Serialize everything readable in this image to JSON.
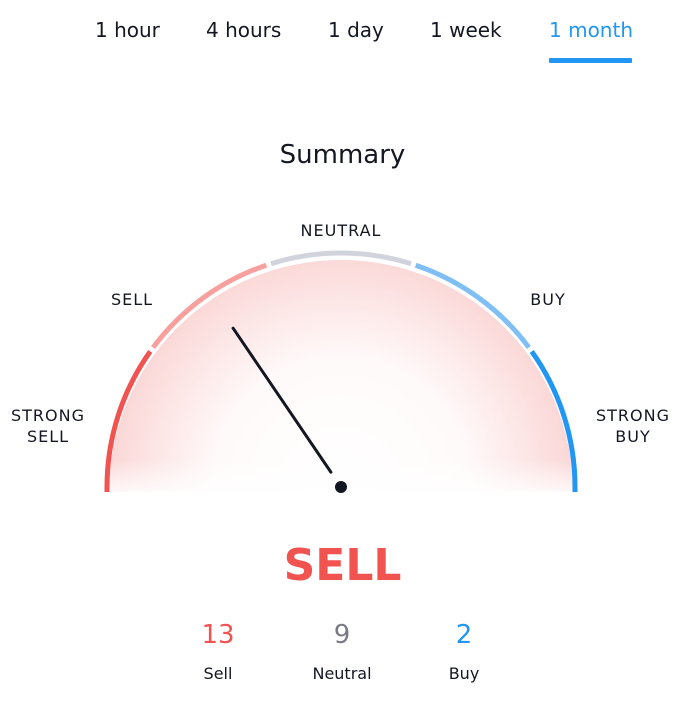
{
  "tabs": [
    {
      "label": "1 hour",
      "active": false
    },
    {
      "label": "4 hours",
      "active": false
    },
    {
      "label": "1 day",
      "active": false
    },
    {
      "label": "1 week",
      "active": false
    },
    {
      "label": "1 month",
      "active": true
    }
  ],
  "title": "Summary",
  "gauge": {
    "labels": {
      "strong_sell_1": "STRONG",
      "strong_sell_2": "SELL",
      "sell": "SELL",
      "neutral": "NEUTRAL",
      "buy": "BUY",
      "strong_buy_1": "STRONG",
      "strong_buy_2": "BUY"
    },
    "needle_value": 0.31,
    "colors": {
      "strong_sell": "#f05350",
      "sell": "#f7a09e",
      "neutral": "#d1d4dc",
      "buy": "#7fbff5",
      "strong_buy": "#2196f3",
      "needle": "#131722"
    }
  },
  "verdict": "SELL",
  "counts": [
    {
      "value": "13",
      "label": "Sell",
      "color": "#f05350"
    },
    {
      "value": "9",
      "label": "Neutral",
      "color": "#787b86"
    },
    {
      "value": "2",
      "label": "Buy",
      "color": "#2196f3"
    }
  ]
}
